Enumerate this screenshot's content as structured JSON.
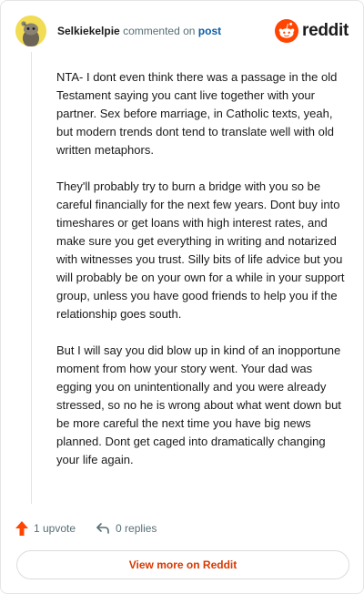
{
  "comment": {
    "username": "Selkiekelpie",
    "action_text": "commented on",
    "post_link": "post",
    "paragraphs": [
      "NTA- I dont even think there was a passage in the old Testament saying you cant live together with your partner. Sex before marriage, in Catholic texts, yeah, but modern trends dont tend to translate well with old written metaphors.",
      "They'll probably try to burn a bridge with you so be careful financially for the next few years. Dont buy into timeshares or get loans with high interest rates, and make sure you get everything in writing and notarized with witnesses you trust. Silly bits of life advice but you will probably be on your own for a while in your support group, unless you have good friends to help you if the relationship goes south.",
      "But I will say you did blow up in kind of an inopportune moment from how your story went. Your dad was egging you on unintentionally and you were already stressed, so no he is wrong about what went down but be more careful the next time you have big news planned. Dont get caged into dramatically changing your life again."
    ]
  },
  "brand": {
    "name": "reddit",
    "icon": "reddit-snoo-icon",
    "color": "#ff4500"
  },
  "actions": {
    "upvote_label": "1 upvote",
    "replies_label": "0 replies",
    "upvote_icon": "upvote-arrow-icon",
    "reply_icon": "reply-arrow-icon",
    "upvote_color": "#ff4500"
  },
  "view_button": {
    "label": "View more on Reddit",
    "color": "#d93900"
  }
}
